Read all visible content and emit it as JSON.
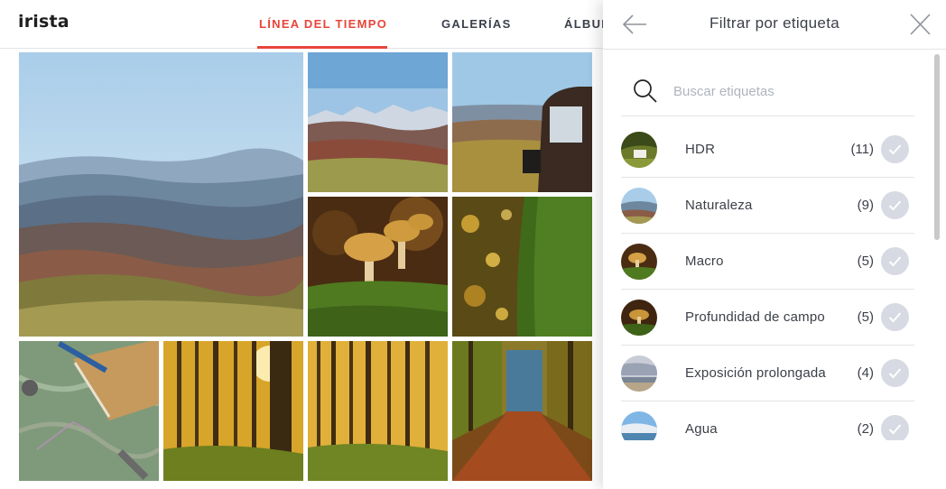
{
  "app": {
    "logo": "irista"
  },
  "nav": {
    "tabs": [
      {
        "label": "LÍNEA DEL TIEMPO",
        "active": true
      },
      {
        "label": "GALERÍAS",
        "active": false
      },
      {
        "label": "ÁLBUMES",
        "active": false
      }
    ]
  },
  "gallery": {
    "photos": [
      {
        "subject": "mountain-valley-landscape"
      },
      {
        "subject": "snowy-mountains-meadow"
      },
      {
        "subject": "vehicle-hills-view"
      },
      {
        "subject": "mushrooms-macro"
      },
      {
        "subject": "mossy-tree-bokeh"
      },
      {
        "subject": "map-notebook-pen"
      },
      {
        "subject": "autumn-forest-sunlight"
      },
      {
        "subject": "autumn-forest-trees"
      },
      {
        "subject": "forest-path-leaves"
      }
    ]
  },
  "filter_panel": {
    "title": "Filtrar por etiqueta",
    "back_icon": "arrow-left-icon",
    "close_icon": "close-icon",
    "search": {
      "placeholder": "Buscar etiquetas",
      "value": "",
      "icon": "search-icon"
    },
    "tags": [
      {
        "label": "HDR",
        "count": "(11)"
      },
      {
        "label": "Naturaleza",
        "count": "(9)"
      },
      {
        "label": "Macro",
        "count": "(5)"
      },
      {
        "label": "Profundidad de campo",
        "count": "(5)"
      },
      {
        "label": "Exposición prolongada",
        "count": "(4)"
      },
      {
        "label": "Agua",
        "count": "(2)"
      }
    ],
    "check_icon": "checkmark-icon"
  },
  "colors": {
    "accent": "#e8443a",
    "text": "#3b3f47",
    "check_bg": "#d7dae3",
    "divider": "#e4e4e4"
  }
}
